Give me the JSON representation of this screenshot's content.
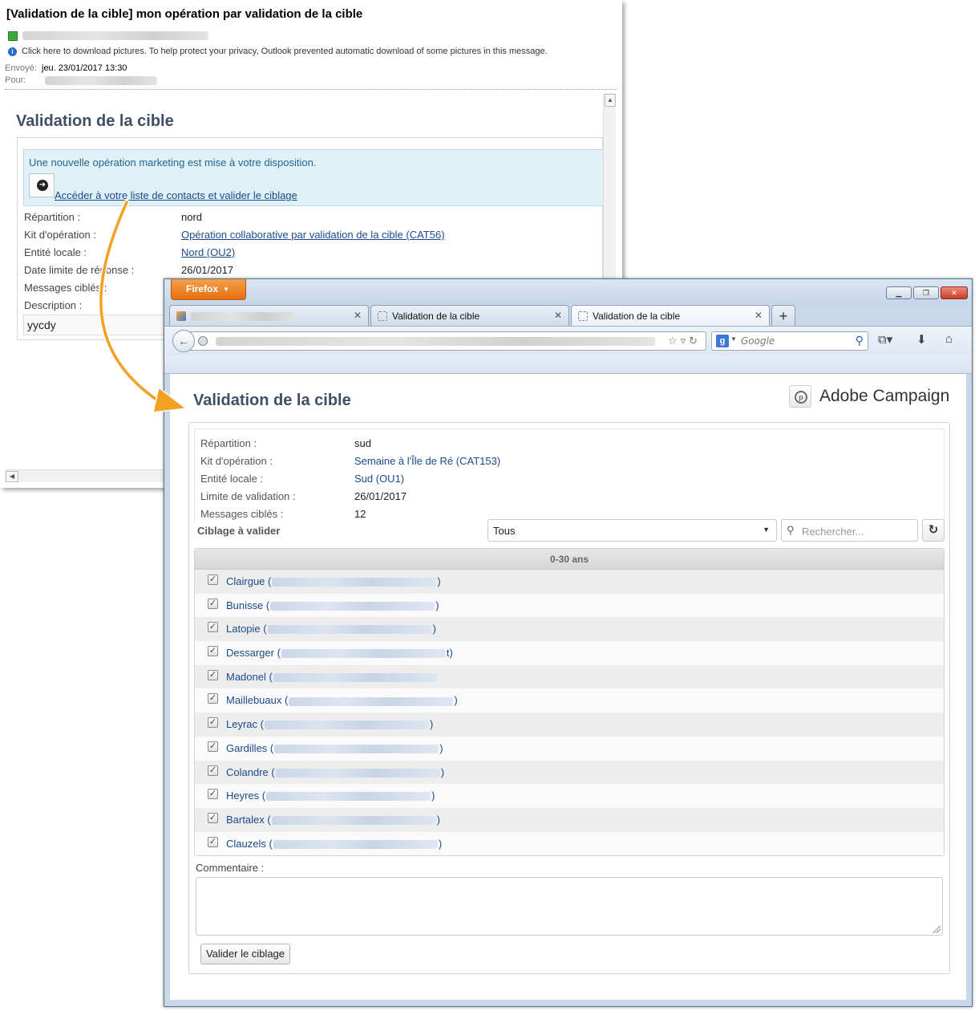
{
  "email": {
    "subject": "[Validation de la cible] mon opération par validation de la cible",
    "info_bar": "Click here to download pictures. To help protect your privacy, Outlook prevented automatic download of some pictures in this message.",
    "sent_label": "Envoyé:",
    "sent_value": "jeu. 23/01/2017 13:30",
    "to_label": "Pour:",
    "title": "Validation de la cible",
    "notice_text": "Une nouvelle opération marketing est mise à votre disposition.",
    "notice_link": "Accéder à votre liste de contacts et valider le ciblage",
    "fields": [
      {
        "label": "Répartition :",
        "value": "nord",
        "link": false
      },
      {
        "label": "Kit d'opération :",
        "value": "Opération collaborative par validation de la cible (CAT56)",
        "link": true
      },
      {
        "label": "Entité locale :",
        "value": "Nord (OU2)",
        "link": true
      },
      {
        "label": "Date limite de réponse :",
        "value": "26/01/2017",
        "link": false
      },
      {
        "label": "Messages ciblés :",
        "value": "",
        "link": false
      },
      {
        "label": "Description :",
        "value": "",
        "link": false
      }
    ],
    "description_value": "yycdy"
  },
  "browser": {
    "menu_button": "Firefox",
    "tabs": [
      {
        "label": ""
      },
      {
        "label": "Validation de la cible"
      },
      {
        "label": "Validation de la cible"
      }
    ],
    "new_tab": "+",
    "search_placeholder": "Google",
    "accent_color": "#e36f12"
  },
  "page": {
    "title": "Validation de la cible",
    "brand": "Adobe Campaign",
    "fields": [
      {
        "label": "Répartition :",
        "value": "sud",
        "link": false
      },
      {
        "label": "Kit d'opération :",
        "value": "Semaine à l'Île de Ré (CAT153)",
        "link": true
      },
      {
        "label": "Entité locale :",
        "value": "Sud (OU1)",
        "link": true
      },
      {
        "label": "Limite de validation :",
        "value": "26/01/2017",
        "link": false
      },
      {
        "label": "Messages ciblés :",
        "value": "12",
        "link": false
      }
    ],
    "targeting_label": "Ciblage à valider",
    "filter_value": "Tous",
    "search_placeholder": "Rechercher...",
    "group_label": "0-30 ans",
    "contacts": [
      {
        "name": "Clairgue",
        "suffix": ")"
      },
      {
        "name": "Bunisse",
        "suffix": ")"
      },
      {
        "name": "Latopie",
        "suffix": ")"
      },
      {
        "name": "Dessarger",
        "suffix": "t)"
      },
      {
        "name": "Madonel",
        "suffix": ""
      },
      {
        "name": "Maillebuaux",
        "suffix": ")"
      },
      {
        "name": "Leyrac",
        "suffix": ")"
      },
      {
        "name": "Gardilles",
        "suffix": ")"
      },
      {
        "name": "Colandre",
        "suffix": ")"
      },
      {
        "name": "Heyres",
        "suffix": ")"
      },
      {
        "name": "Bartalex",
        "suffix": ")"
      },
      {
        "name": "Clauzels",
        "suffix": ")"
      }
    ],
    "comment_label": "Commentaire :",
    "submit_label": "Valider le ciblage"
  }
}
